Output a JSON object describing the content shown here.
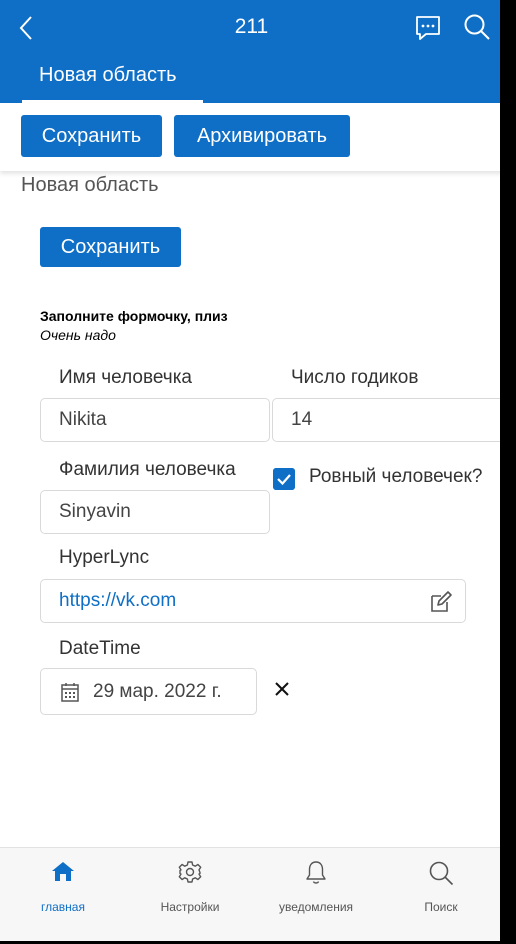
{
  "appbar": {
    "title": "211",
    "tab_label": "Новая область"
  },
  "toolbar": {
    "save_label": "Сохранить",
    "archive_label": "Архивировать"
  },
  "section": {
    "title": "Новая область",
    "save_label": "Сохранить"
  },
  "form": {
    "title": "Заполните формочку, плиз",
    "subtitle": "Очень надо",
    "name_label": "Имя человечка",
    "name_value": "Nikita",
    "age_label": "Число годиков",
    "age_value": "14",
    "surname_label": "Фамилия человечка",
    "surname_value": "Sinyavin",
    "check_label": "Ровный человечек?",
    "check_checked": true,
    "link_label": "HyperLync",
    "link_value": "https://vk.com",
    "date_label": "DateTime",
    "date_value": "29 мар. 2022 г."
  },
  "bottomnav": {
    "items": [
      {
        "label": "главная",
        "icon": "home-icon",
        "active": true
      },
      {
        "label": "Настройки",
        "icon": "gear-icon",
        "active": false
      },
      {
        "label": "уведомления",
        "icon": "bell-icon",
        "active": false
      },
      {
        "label": "Поиск",
        "icon": "search-icon",
        "active": false
      }
    ]
  },
  "colors": {
    "accent": "#0f6fc6",
    "inactive": "#555555"
  }
}
